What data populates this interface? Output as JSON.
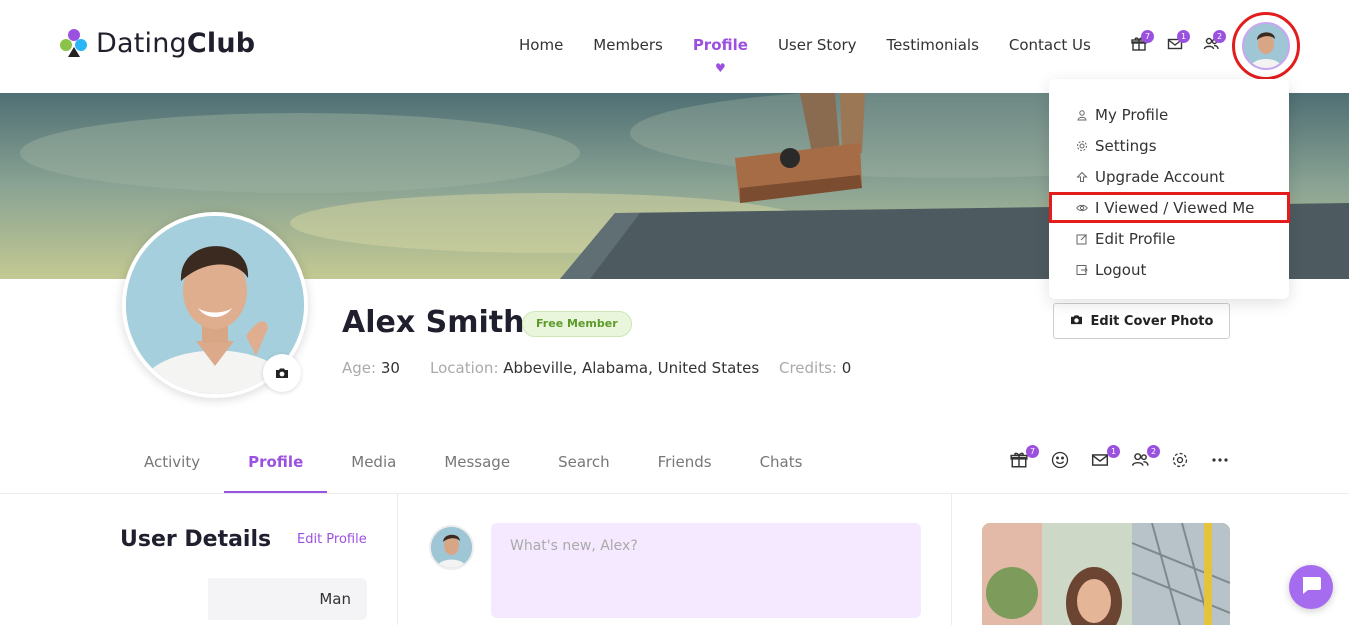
{
  "brand": {
    "name_light": "Dating",
    "name_bold": "Club"
  },
  "nav": {
    "items": [
      {
        "label": "Home",
        "active": false
      },
      {
        "label": "Members",
        "active": false
      },
      {
        "label": "Profile",
        "active": true
      },
      {
        "label": "User Story",
        "active": false
      },
      {
        "label": "Testimonials",
        "active": false
      },
      {
        "label": "Contact Us",
        "active": false
      }
    ]
  },
  "header_icons": {
    "gifts": {
      "icon": "gift-icon",
      "count": "7"
    },
    "messages": {
      "icon": "mail-icon",
      "count": "1"
    },
    "friends": {
      "icon": "users-icon",
      "count": "2"
    }
  },
  "user_menu": {
    "items": [
      {
        "label": "My Profile",
        "icon": "user-icon"
      },
      {
        "label": "Settings",
        "icon": "gear-icon"
      },
      {
        "label": "Upgrade Account",
        "icon": "upgrade-arrow-icon"
      },
      {
        "label": "I Viewed / Viewed Me",
        "icon": "eye-icon"
      },
      {
        "label": "Edit Profile",
        "icon": "edit-icon"
      },
      {
        "label": "Logout",
        "icon": "logout-icon"
      }
    ]
  },
  "profile": {
    "name": "Alex Smith",
    "membership": "Free Member",
    "age_label": "Age:",
    "age": "30",
    "location_label": "Location:",
    "location": "Abbeville, Alabama, United States",
    "credits_label": "Credits:",
    "credits": "0",
    "edit_cover_label": "Edit Cover Photo"
  },
  "tabs": [
    {
      "label": "Activity",
      "active": false
    },
    {
      "label": "Profile",
      "active": true
    },
    {
      "label": "Media",
      "active": false
    },
    {
      "label": "Message",
      "active": false
    },
    {
      "label": "Search",
      "active": false
    },
    {
      "label": "Friends",
      "active": false
    },
    {
      "label": "Chats",
      "active": false
    }
  ],
  "tab_icons": {
    "gifts_count": "7",
    "messages_count": "1",
    "friends_count": "2"
  },
  "user_details": {
    "title": "User Details",
    "edit_label": "Edit Profile",
    "gender_value": "Man"
  },
  "post": {
    "placeholder": "What's new, Alex?"
  },
  "colors": {
    "accent": "#9b51e0",
    "highlight": "#e31c1c",
    "badge_green": "#5a9b2a"
  }
}
